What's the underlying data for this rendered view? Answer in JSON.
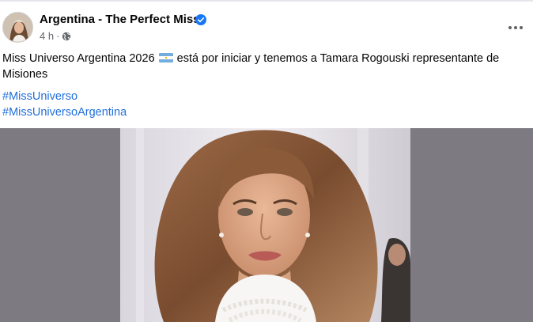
{
  "post": {
    "page_name": "Argentina - The Perfect Miss",
    "verified_icon": "verified-badge-icon",
    "time": "4 h",
    "separator": "·",
    "audience_icon": "globe-icon",
    "more_icon": "more-options-icon",
    "text_before_flag": "Miss Universo Argentina 2026 ",
    "flag_icon": "argentina-flag-icon",
    "text_after_flag": " está por iniciar y tenemos a Tamara Rogouski representante de Misiones",
    "hashtags": [
      "#MissUniverso",
      "#MissUniversoArgentina"
    ]
  },
  "colors": {
    "link": "#216fdb",
    "secondary_text": "#65676b",
    "verified": "#1877f2",
    "media_background": "#7d7a82"
  }
}
